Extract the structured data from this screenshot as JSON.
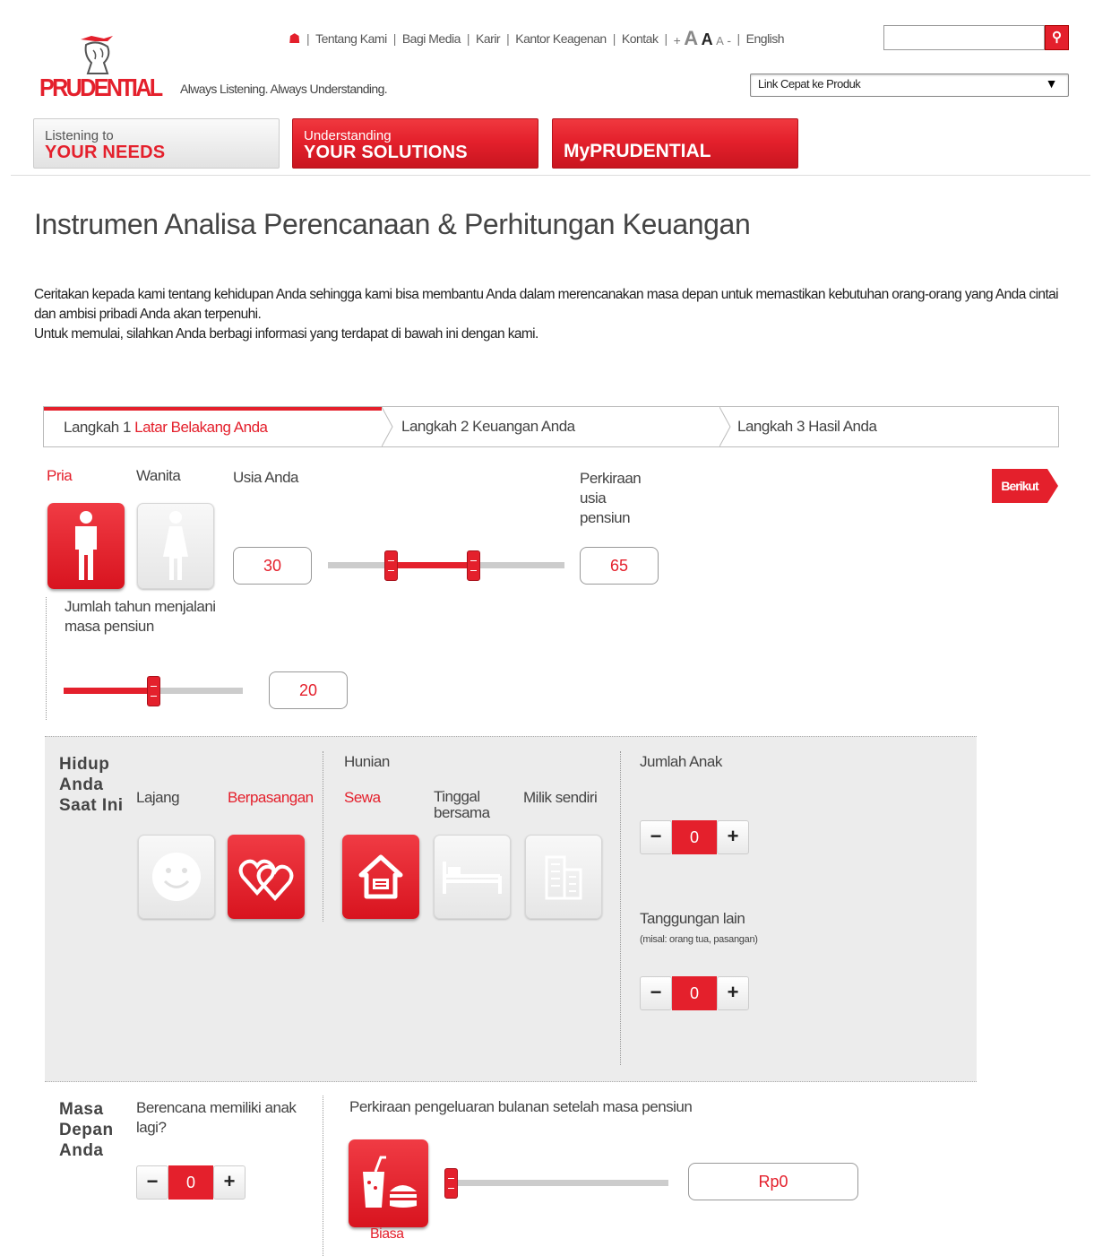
{
  "header": {
    "logo_text": "PRUDENTIAL",
    "tagline": "Always Listening. Always Understanding.",
    "top_links": [
      "Tentang Kami",
      "Bagi Media",
      "Karir",
      "Kantor Keagenan",
      "Kontak"
    ],
    "font_size_labels": {
      "increase": "+",
      "large": "A",
      "medium": "A",
      "small": "A",
      "decrease": "-"
    },
    "language": "English",
    "search_placeholder": "",
    "quick_link": "Link Cepat ke Produk",
    "main_tabs": [
      {
        "line1": "Listening to",
        "line2": "YOUR NEEDS",
        "active": false
      },
      {
        "line1": "Understanding",
        "line2": "YOUR SOLUTIONS",
        "active": true
      },
      {
        "line1": "",
        "line2": "MyPRUDENTIAL",
        "active": true
      }
    ]
  },
  "page": {
    "title": "Instrumen Analisa Perencanaan & Perhitungan Keuangan",
    "intro_line1": "Ceritakan kepada kami tentang kehidupan Anda sehingga kami bisa membantu Anda dalam merencanakan masa depan untuk memastikan kebutuhan orang-orang yang Anda cintai dan ambisi pribadi Anda akan terpenuhi.",
    "intro_line2": "Untuk memulai, silahkan Anda berbagi informasi yang terdapat di bawah ini dengan kami."
  },
  "steps": {
    "step1_prefix": "Langkah 1",
    "step1_name": "Latar Belakang Anda",
    "step2": "Langkah 2 Keuangan Anda",
    "step3": "Langkah 3 Hasil Anda",
    "next_button": "Berikut"
  },
  "profile": {
    "gender_male": "Pria",
    "gender_female": "Wanita",
    "selected_gender": "Pria",
    "age_label": "Usia Anda",
    "age_value": "30",
    "retire_label_1": "Perkiraan",
    "retire_label_2": "usia",
    "retire_label_3": "pensiun",
    "retire_value": "65",
    "age_slider_range": [
      30,
      65
    ],
    "years_label_1": "Jumlah tahun menjalani",
    "years_label_2": "masa pensiun",
    "years_value": "20",
    "years_slider_fraction": 0.5
  },
  "life": {
    "section_title": [
      "Hidup",
      "Anda",
      "Saat Ini"
    ],
    "single_label": "Lajang",
    "married_label": "Berpasangan",
    "housing_title": "Hunian",
    "rent_label": "Sewa",
    "with_family_label_1": "Tinggal",
    "with_family_label_2": "bersama",
    "own_label": "Milik sendiri",
    "children_label": "Jumlah Anak",
    "children_value": "0",
    "dependents_label": "Tanggungan lain",
    "dependents_hint": "(misal: orang tua, pasangan)",
    "dependents_value": "0",
    "minus": "−",
    "plus": "+"
  },
  "future": {
    "section_title": [
      "Masa",
      "Depan",
      "Anda"
    ],
    "more_children_label_1": "Berencana memiliki anak",
    "more_children_label_2": "lagi?",
    "more_children_value": "0",
    "expense_label": "Perkiraan pengeluaran bulanan setelah masa pensiun",
    "expense_level": "Biasa",
    "expense_value": "Rp0",
    "expense_slider_fraction": 0
  },
  "colors": {
    "brand_red": "#e4202c",
    "panel_grey": "#ececec"
  }
}
